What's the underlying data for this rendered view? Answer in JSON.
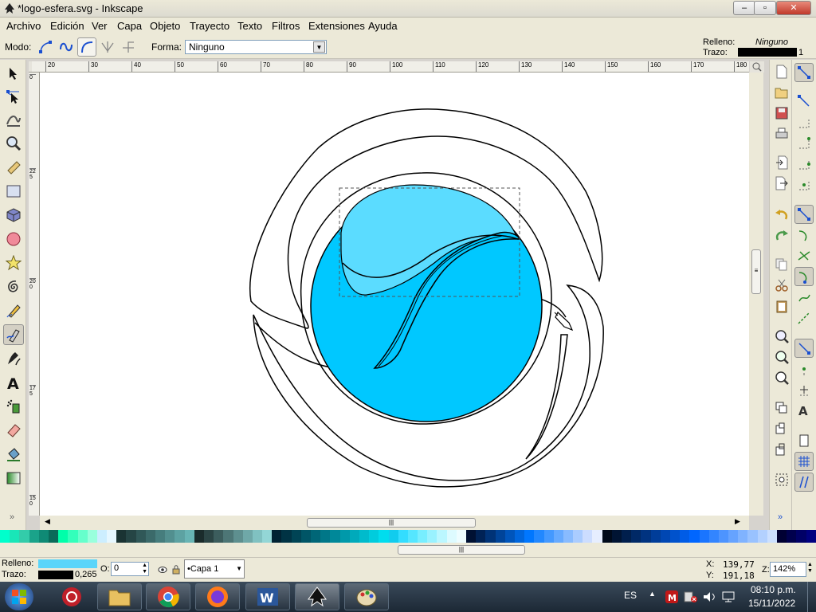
{
  "window": {
    "title": "*logo-esfera.svg - Inkscape",
    "minimize": "–",
    "maximize": "▫",
    "close": "✕"
  },
  "menubar": {
    "items": [
      "Archivo",
      "Edición",
      "Ver",
      "Capa",
      "Objeto",
      "Trayecto",
      "Texto",
      "Filtros",
      "Extensiones",
      "Ayuda"
    ]
  },
  "tool_controls": {
    "mode_label": "Modo:",
    "shape_label": "Forma:",
    "shape_value": "Ninguno"
  },
  "fill_stroke_indicator": {
    "fill_label": "Relleno:",
    "fill_value": "Ninguno",
    "stroke_label": "Trazo:",
    "stroke_width": "1"
  },
  "rulers": {
    "horizontal": [
      "20",
      "30",
      "40",
      "50",
      "60",
      "70",
      "80",
      "90",
      "100",
      "110",
      "120",
      "130",
      "140",
      "150",
      "160",
      "170",
      "180"
    ],
    "vertical": [
      "0",
      "225",
      "200",
      "175",
      "150"
    ]
  },
  "status": {
    "fill_label": "Relleno:",
    "stroke_label": "Trazo:",
    "stroke_width": "0,265",
    "opacity_label": "O:",
    "opacity_value": "0",
    "layer_name": "•Capa 1",
    "x_label": "X:",
    "x_value": "139,77",
    "y_label": "Y:",
    "y_value": "191,18",
    "zoom_label": "Z:",
    "zoom_value": "142%"
  },
  "taskbar": {
    "language": "ES",
    "time": "08:10 p.m.",
    "date": "15/11/2022"
  },
  "colors": {
    "fill": "#5bd5fa",
    "sphere": "#00c8ff",
    "highlight": "#5bdcff",
    "stroke": "#000000"
  },
  "palette": [
    "#00ffcc",
    "#19e6b8",
    "#33ccaa",
    "#1aa38a",
    "#0f8a75",
    "#0a6b5a",
    "#00ffaa",
    "#33ffbb",
    "#66ffcc",
    "#99ffdd",
    "#cceeff",
    "#e6f7ff",
    "#1a3333",
    "#254545",
    "#305858",
    "#3b6a6a",
    "#467d7d",
    "#528f8f",
    "#5da2a2",
    "#68b4b4",
    "#1a2b2b",
    "#2b4444",
    "#3c5d5d",
    "#4d7676",
    "#5e8f8f",
    "#6fa8a8",
    "#80c1c1",
    "#93d6d6",
    "#002233",
    "#003344",
    "#004455",
    "#005566",
    "#006677",
    "#007788",
    "#008899",
    "#0099aa",
    "#00aabb",
    "#00bbcc",
    "#00ccdd",
    "#00ddee",
    "#11ccee",
    "#33ddff",
    "#55e6ff",
    "#77eeff",
    "#99f2ff",
    "#bbf7ff",
    "#ddfbff",
    "#eefdff",
    "#001133",
    "#002255",
    "#003377",
    "#004499",
    "#0055bb",
    "#0066dd",
    "#0077ff",
    "#2288ff",
    "#4499ff",
    "#66aaff",
    "#88bbff",
    "#aaccff",
    "#ccddff",
    "#e6eeff",
    "#000a1a",
    "#001433",
    "#001f4d",
    "#002966",
    "#003380",
    "#003d99",
    "#0047b3",
    "#0052cc",
    "#005ce6",
    "#0066ff",
    "#1a75ff",
    "#3385ff",
    "#4d94ff",
    "#66a3ff",
    "#80b3ff",
    "#99c2ff",
    "#b3d1ff",
    "#cce0ff",
    "#000033",
    "#00004d",
    "#000066",
    "#000080"
  ]
}
